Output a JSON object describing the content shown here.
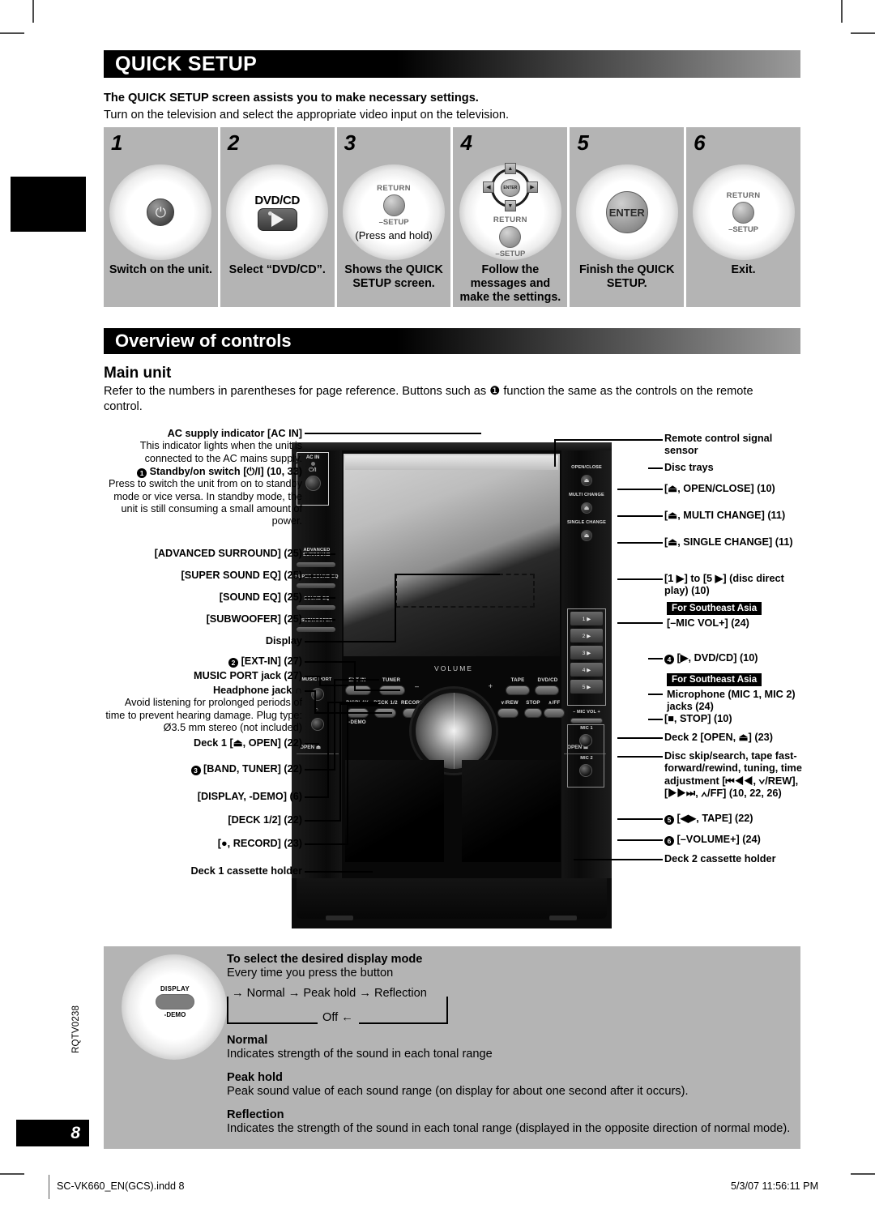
{
  "section_quick_setup": {
    "title": "QUICK SETUP",
    "lead_bold": "The QUICK SETUP screen assists you to make necessary settings.",
    "lead_normal": "Turn on the television and select the appropriate video input on the television.",
    "steps": [
      {
        "num": "1",
        "caption": "Switch on the unit.",
        "art": "power-button",
        "power_glyph": "⏻"
      },
      {
        "num": "2",
        "caption": "Select “DVD/CD”.",
        "art": "dvdcd-button",
        "button_label": "DVD/CD"
      },
      {
        "num": "3",
        "caption": "Shows the QUICK SETUP screen.",
        "art": "return-setup-button",
        "top_label": "RETURN",
        "bottom_label": "–SETUP",
        "note": "(Press and hold)"
      },
      {
        "num": "4",
        "caption": "Follow the messages and make the settings.",
        "art": "dpad-return-setup",
        "center_label": "ENTER",
        "top_label": "RETURN",
        "bottom_label": "–SETUP"
      },
      {
        "num": "5",
        "caption": "Finish the QUICK SETUP.",
        "art": "enter-button",
        "button_label": "ENTER"
      },
      {
        "num": "6",
        "caption": "Exit.",
        "art": "return-setup-button",
        "top_label": "RETURN",
        "bottom_label": "–SETUP"
      }
    ]
  },
  "section_overview": {
    "title": "Overview of controls",
    "subtitle": "Main unit",
    "intro": "Refer to the numbers in parentheses for page reference. Buttons such as ❶ function the same as the controls on the remote control."
  },
  "diagram": {
    "left_callouts": [
      {
        "heading": "AC supply indicator [AC IN]",
        "body": "This indicator lights when the unit is connected to the AC mains supply."
      },
      {
        "badge": "1",
        "heading": "Standby/on switch [⏻/I] (10, 33)",
        "body": "Press to switch the unit from on to standby mode or vice versa. In standby mode, the unit is still consuming a small amount of power."
      },
      {
        "heading": "[ADVANCED SURROUND] (25)"
      },
      {
        "heading": "[SUPER SOUND EQ] (25)"
      },
      {
        "heading": "[SOUND EQ] (25)"
      },
      {
        "heading": "[SUBWOOFER] (25)"
      },
      {
        "heading": "Display"
      },
      {
        "badge": "2",
        "heading": "[EXT-IN] (27)"
      },
      {
        "heading": "MUSIC PORT jack (27)"
      },
      {
        "heading": "Headphone jack ∩",
        "body": "Avoid listening for prolonged periods of time to prevent hearing damage. Plug type: Ø3.5 mm stereo (not included)"
      },
      {
        "heading": "Deck 1 [⏏, OPEN] (22)"
      },
      {
        "badge": "3",
        "heading": "[BAND, TUNER] (22)"
      },
      {
        "heading": "[DISPLAY, -DEMO] (6)"
      },
      {
        "heading": "[DECK 1/2] (22)"
      },
      {
        "heading": "[●, RECORD] (23)"
      },
      {
        "heading": "Deck 1 cassette holder"
      }
    ],
    "right_callouts": [
      {
        "heading": "Remote control signal sensor"
      },
      {
        "heading": "Disc trays"
      },
      {
        "heading": "[⏏, OPEN/CLOSE] (10)"
      },
      {
        "heading": "[⏏, MULTI CHANGE] (11)"
      },
      {
        "heading": "[⏏, SINGLE CHANGE] (11)"
      },
      {
        "heading": "[1 ▶] to [5 ▶] (disc direct play) (10)"
      },
      {
        "tag": "For Southeast Asia",
        "heading": "[–MIC VOL+] (24)"
      },
      {
        "badge": "4",
        "heading": "[▶, DVD/CD] (10)"
      },
      {
        "tag": "For Southeast Asia",
        "heading": "Microphone (MIC 1, MIC 2) jacks (24)"
      },
      {
        "heading": "[■, STOP] (10)"
      },
      {
        "heading": "Deck 2 [OPEN, ⏏] (23)"
      },
      {
        "heading": "Disc skip/search, tape fast-forward/rewind, tuning, time adjustment [⏮◀◀, ∨/REW], [▶▶⏭, ∧/FF] (10, 22, 26)"
      },
      {
        "badge": "5",
        "heading": "[◀▶, TAPE] (22)"
      },
      {
        "badge": "6",
        "heading": "[–VOLUME+] (24)"
      },
      {
        "heading": "Deck 2 cassette holder"
      }
    ],
    "unit_labels": {
      "ac_in": "AC IN",
      "power": "⏻/I",
      "advanced_surround": "ADVANCED SURROUND",
      "super_sound_eq": "SUPER SOUND EQ",
      "sound_eq": "SOUND EQ",
      "subwoofer": "SUBWOOFER",
      "music_port": "MUSIC PORT",
      "headphone": "∩",
      "ext_in": "EXT-IN",
      "tuner": "TUNER",
      "band": "BAND",
      "volume": "VOLUME",
      "vol_minus": "–",
      "vol_plus": "+",
      "tape": "TAPE",
      "dvd_cd": "DVD/CD",
      "open_close": "OPEN/CLOSE",
      "multi_change": "MULTI CHANGE",
      "single_change": "SINGLE CHANGE",
      "mic_vol": "–  MIC VOL  +",
      "mic1": "MIC 1",
      "mic2": "MIC 2",
      "display": "DISPLAY",
      "deck12": "DECK 1/2",
      "record": "RECORD",
      "demo": "-DEMO",
      "rew": "∨/REW",
      "stop": "STOP",
      "ff": "∧/FF",
      "open_left": "OPEN ⏏",
      "open_right": "OPEN ⏏",
      "disc_numbers": [
        "1 ▶",
        "2 ▶",
        "3 ▶",
        "4 ▶",
        "5 ▶"
      ]
    }
  },
  "display_mode": {
    "button": {
      "top": "DISPLAY",
      "bottom": "-DEMO"
    },
    "heading": "To select the desired display mode",
    "subheading": "Every time you press the button",
    "cycle_top": "→ Normal → Peak hold → Reflection",
    "cycle_bottom": "Off ←",
    "modes": [
      {
        "name": "Normal",
        "desc": "Indicates strength of the sound in each tonal range"
      },
      {
        "name": "Peak hold",
        "desc": "Peak sound value of each sound range (on display for about one second after it occurs)."
      },
      {
        "name": "Reflection",
        "desc": "Indicates the strength of the sound in each tonal range (displayed in the opposite direction of normal mode)."
      }
    ]
  },
  "page": {
    "number": "8",
    "side_code": "RQTV0238",
    "footer_left": "SC-VK660_EN(GCS).indd   8",
    "footer_right": "5/3/07   11:56:11 PM"
  }
}
